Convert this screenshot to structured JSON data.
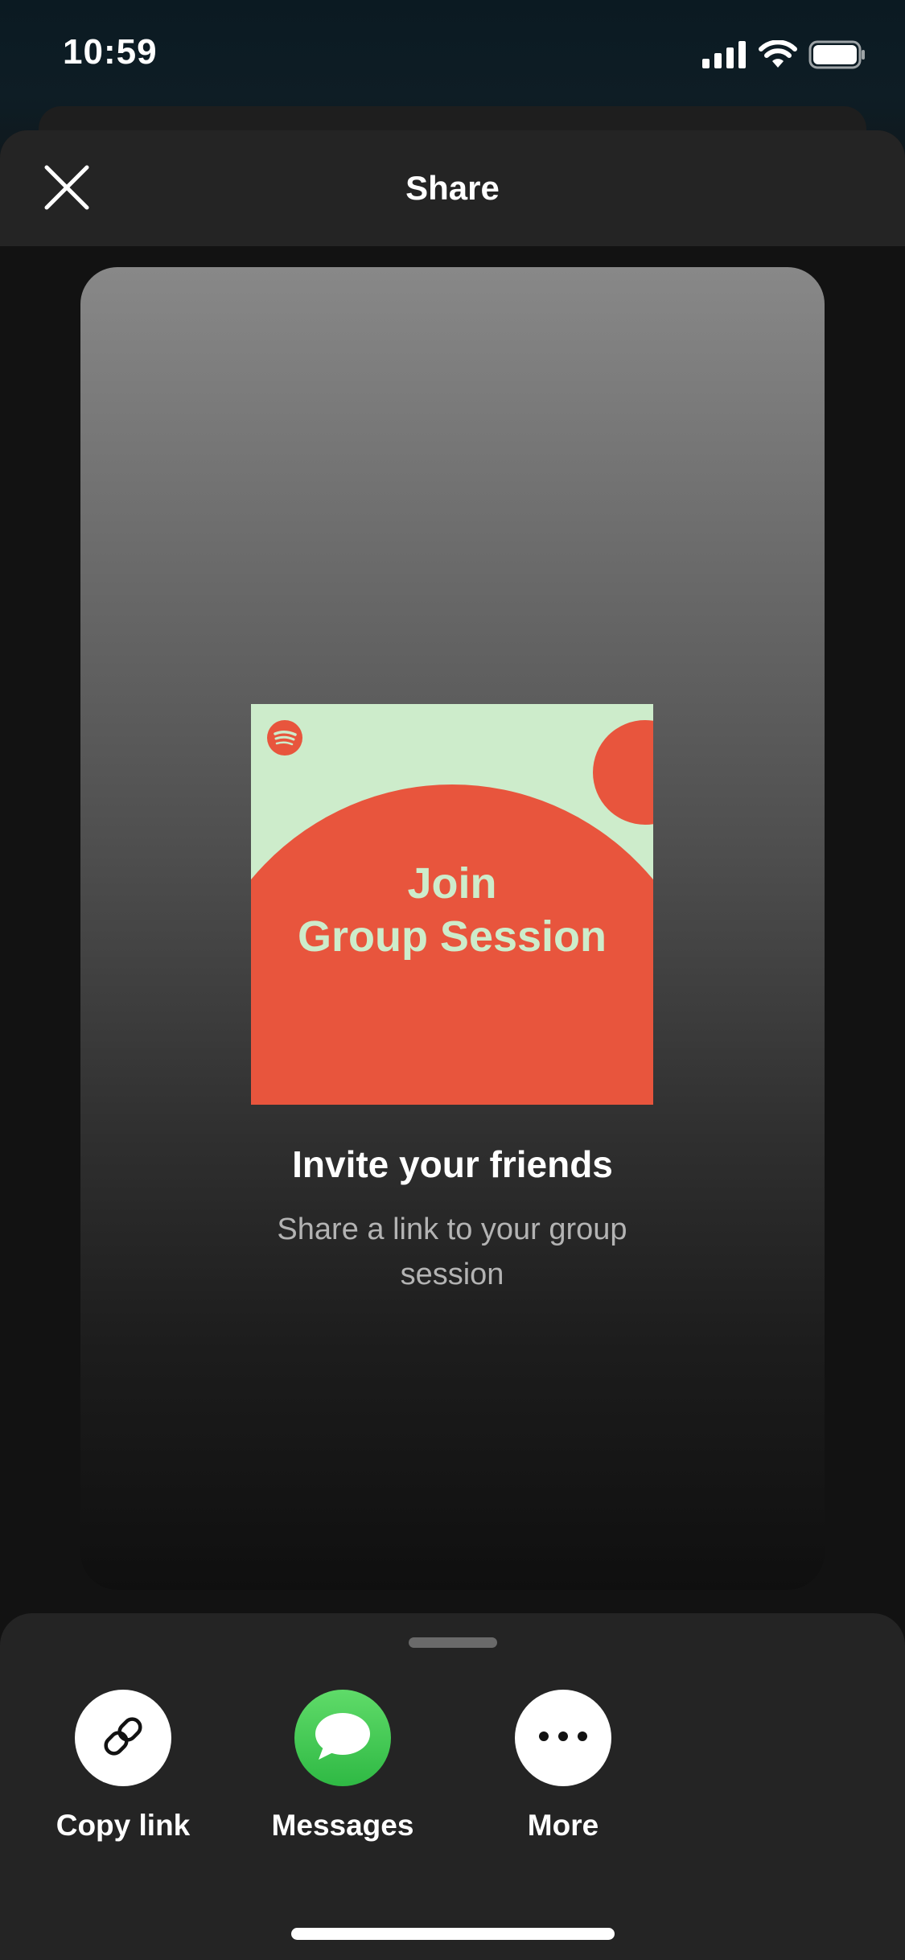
{
  "status_bar": {
    "time": "10:59",
    "icons": [
      "signal-icon",
      "wifi-icon",
      "battery-icon"
    ]
  },
  "header": {
    "title": "Share",
    "close_icon": "close-icon"
  },
  "preview": {
    "cover": {
      "line1": "Join",
      "line2": "Group Session",
      "logo": "spotify-logo-icon",
      "colors": {
        "background": "#cdeccb",
        "accent": "#e8553d"
      }
    },
    "title": "Invite your friends",
    "subtitle": "Share a link to your group session"
  },
  "share_options": [
    {
      "label": "Copy link",
      "icon": "link-icon"
    },
    {
      "label": "Messages",
      "icon": "messages-icon"
    },
    {
      "label": "More",
      "icon": "more-icon"
    }
  ],
  "colors": {
    "sheet_header": "#242424",
    "messages_green": "#3dc24f"
  }
}
